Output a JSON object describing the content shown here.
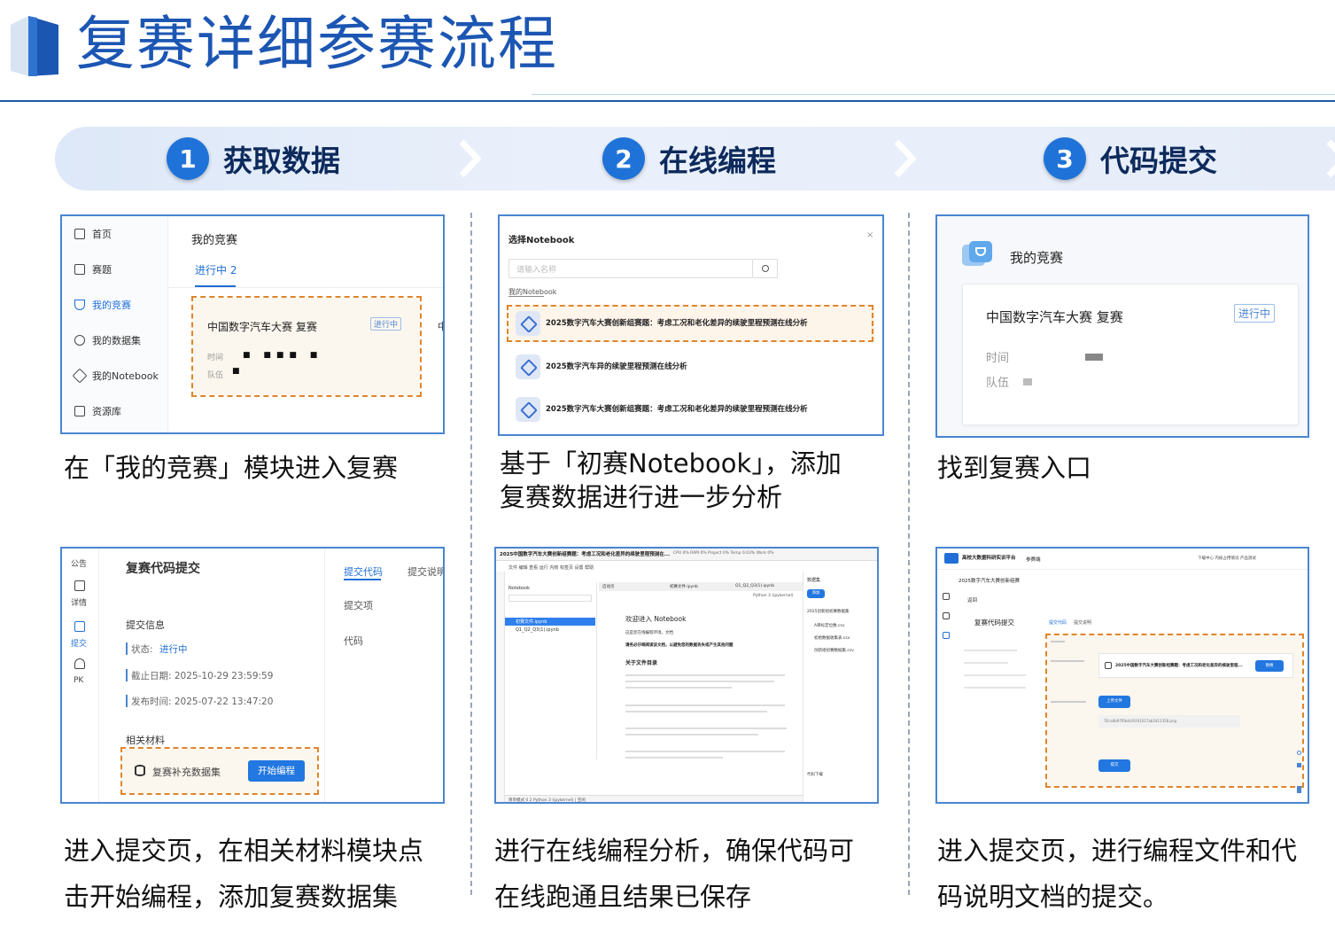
{
  "page_title": "复赛详细参赛流程",
  "steps": [
    {
      "num": "1",
      "label": "获取数据"
    },
    {
      "num": "2",
      "label": "在线编程"
    },
    {
      "num": "3",
      "label": "代码提交"
    }
  ],
  "captions": {
    "p1": "在「我的竞赛」模块进入复赛",
    "p2_line1": "基于「初赛Notebook」，添加",
    "p2_line2": "复赛数据进行进一步分析",
    "p3": "找到复赛入口",
    "p4_line1": "进入提交页，在相关材料模块点",
    "p4_line2": "击开始编程，添加复赛数据集",
    "p5_line1": "进行在线编程分析，确保代码可",
    "p5_line2": "在线跑通且结果已保存",
    "p6_line1": "进入提交页，进行编程文件和代",
    "p6_line2": "码说明文档的提交。"
  },
  "panel1": {
    "nav": [
      "首页",
      "赛题",
      "我的竞赛",
      "我的数据集",
      "我的Notebook",
      "资源库"
    ],
    "heading": "我的竞赛",
    "tab": "进行中 2",
    "card_title": "中国数字汽车大赛 复赛",
    "badge": "进行中",
    "time_label": "时间",
    "team_label": "队伍",
    "edge_char": "中"
  },
  "panel2": {
    "title": "选择Notebook",
    "close": "×",
    "search_placeholder": "请输入名称",
    "section": "我的Notebook",
    "items": [
      "2025数字汽车大赛创新组赛题：考虑工况和老化差异的续驶里程预测在线分析",
      "2025数字汽车异的续驶里程预测在线分析",
      "2025数字汽车大赛创新组赛题：考虑工况和老化差异的续驶里程预测在线分析"
    ]
  },
  "panel3": {
    "heading": "我的竞赛",
    "card_title": "中国数字汽车大赛 复赛",
    "badge": "进行中",
    "time_label": "时间",
    "team_label": "队伍"
  },
  "panel4": {
    "side": [
      "公告",
      "详情",
      "提交",
      "PK"
    ],
    "title": "复赛代码提交",
    "tabs": [
      "提交代码",
      "提交说明"
    ],
    "info_heading": "提交信息",
    "status_label": "状态:",
    "status_value": "进行中",
    "deadline": "截止日期: 2025-10-29 23:59:59",
    "published": "发布时间: 2025-07-22 13:47:20",
    "col_labels": [
      "提交项",
      "代码"
    ],
    "materials": "相关材料",
    "dataset": "复赛补充数据集",
    "start_btn": "开始编程"
  },
  "panel5": {
    "topbar": "2025中国数字汽车大赛创新组赛题：考虑工况和老化差异的续驶里程预测在...",
    "stats": "CPU 0%  RAM 0%  Project 0%  Temp 0.03%  Work 0%",
    "menu": "文件  编辑  查看  运行  内核  标签页  设置  帮助",
    "explorer_title": "Notebook",
    "files": [
      "初赛文件.ipynb",
      "Q1_Q2_Q3(1).ipynb"
    ],
    "tabs": [
      "启动页",
      "初赛文件.ipynb",
      "Q1_Q2_Q3(1).ipynb"
    ],
    "welcome": "欢迎进入 Notebook",
    "intro": "这是您在线编程环境，文档",
    "note": "请务必仔细阅读该文档，以避免您的数据丢失或产生其他问题",
    "about": "关于文件目录",
    "dataset_title": "数据集",
    "add": "添加",
    "ds_group": "2025创新组初赛数据集",
    "ds_files": [
      "A目标定位数.csv",
      "初始数据收集表.csv",
      "创新组初赛数据集.csv"
    ],
    "download": "代码下载",
    "kernel": "Python 3 (ipykernel)",
    "status_line": "简单模式  0  2  Python 3 (ipykernel) | 空闲"
  },
  "panel6": {
    "brand": "高校大数据科研实训平台",
    "nav": "参赛端",
    "header_right": "下载中心  内核占用情况  产品测试",
    "crumb": "2025数字汽车大赛创新组赛",
    "back": "返回",
    "title": "复赛代码提交",
    "tabs": [
      "提交代码",
      "提交说明"
    ],
    "notebook_file": "2025中国数字汽车大赛创新组赛题：考虑工况和老化差异的续驶里程...",
    "select_btn": "替换",
    "upload_btn": "上传文件",
    "file_name": "7Eca0b97f0b4c91fd1017ab2d11358.png",
    "submit_btn": "提交"
  }
}
